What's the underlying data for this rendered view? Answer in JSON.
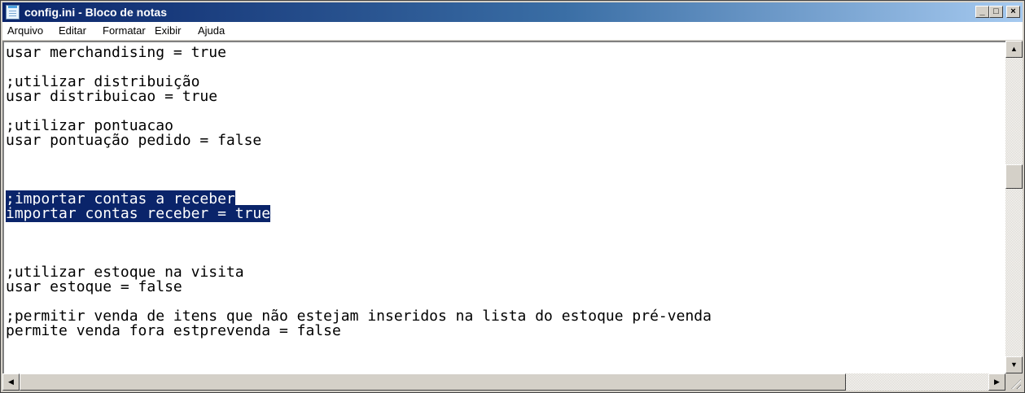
{
  "window": {
    "title": "config.ini - Bloco de notas",
    "minimize_glyph": "_",
    "maximize_glyph": "□",
    "close_glyph": "×"
  },
  "menu": [
    {
      "label": "Arquivo"
    },
    {
      "label": "Editar"
    },
    {
      "label": "Formatar"
    },
    {
      "label": "Exibir"
    },
    {
      "label": "Ajuda"
    }
  ],
  "editor": {
    "lines": [
      {
        "text": "usar merchandising = true",
        "selected": false
      },
      {
        "text": "",
        "selected": false
      },
      {
        "text": ";utilizar distribuição",
        "selected": false
      },
      {
        "text": "usar distribuicao = true",
        "selected": false
      },
      {
        "text": "",
        "selected": false
      },
      {
        "text": ";utilizar pontuacao",
        "selected": false
      },
      {
        "text": "usar pontuação pedido = false",
        "selected": false
      },
      {
        "text": "",
        "selected": false
      },
      {
        "text": "",
        "selected": false
      },
      {
        "text": "",
        "selected": false
      },
      {
        "text": ";importar contas a receber",
        "selected": true
      },
      {
        "text": "importar contas receber = true",
        "selected": true
      },
      {
        "text": "",
        "selected": false
      },
      {
        "text": "",
        "selected": false
      },
      {
        "text": "",
        "selected": false
      },
      {
        "text": ";utilizar estoque na visita",
        "selected": false
      },
      {
        "text": "usar estoque = false",
        "selected": false
      },
      {
        "text": "",
        "selected": false
      },
      {
        "text": ";permitir venda de itens que não estejam inseridos na lista do estoque pré-venda",
        "selected": false
      },
      {
        "text": "permite venda fora estprevenda = false",
        "selected": false
      }
    ]
  },
  "scrollbars": {
    "up_arrow": "▲",
    "down_arrow": "▼",
    "left_arrow": "◀",
    "right_arrow": "▶"
  },
  "colors": {
    "selection_bg": "#0a246a",
    "selection_fg": "#ffffff",
    "title_gradient_start": "#0a246a",
    "title_gradient_end": "#a6caf0"
  }
}
